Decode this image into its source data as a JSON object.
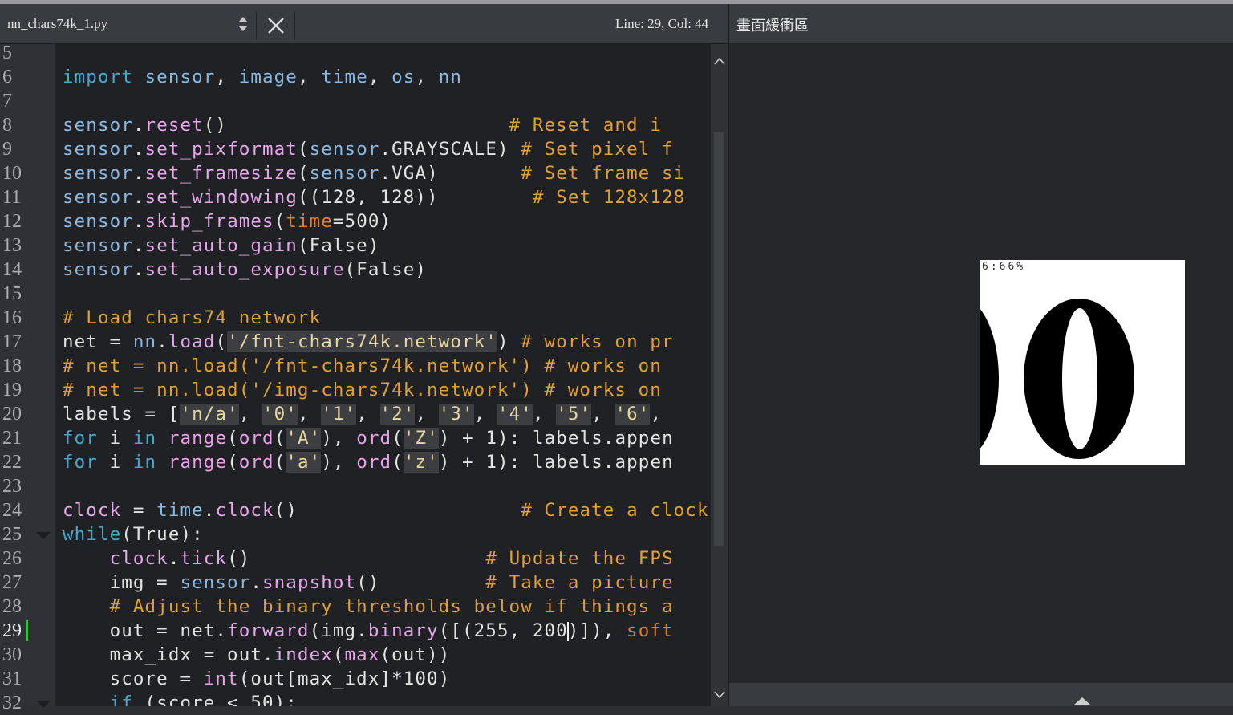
{
  "editor": {
    "file_name": "nn_chars74k_1.py",
    "cursor_position": "Line: 29, Col: 44",
    "lines": [
      {
        "n": "5"
      },
      {
        "n": "6"
      },
      {
        "n": "7"
      },
      {
        "n": "8"
      },
      {
        "n": "9"
      },
      {
        "n": "10"
      },
      {
        "n": "11"
      },
      {
        "n": "12"
      },
      {
        "n": "13"
      },
      {
        "n": "14"
      },
      {
        "n": "15"
      },
      {
        "n": "16"
      },
      {
        "n": "17"
      },
      {
        "n": "18"
      },
      {
        "n": "19"
      },
      {
        "n": "20"
      },
      {
        "n": "21"
      },
      {
        "n": "22"
      },
      {
        "n": "23"
      },
      {
        "n": "24"
      },
      {
        "n": "25"
      },
      {
        "n": "26"
      },
      {
        "n": "27"
      },
      {
        "n": "28"
      },
      {
        "n": "29"
      },
      {
        "n": "30"
      },
      {
        "n": "31"
      },
      {
        "n": "32"
      }
    ],
    "current_line": "29",
    "code": {
      "l6": [
        "import",
        " sensor",
        ", ",
        "image",
        ", ",
        "time",
        ", ",
        "os",
        ", ",
        "nn"
      ],
      "l8": [
        "sensor",
        ".",
        "reset",
        "()",
        "                        ",
        "# Reset and i"
      ],
      "l9": [
        "sensor",
        ".",
        "set_pixformat",
        "(",
        "sensor",
        ".GRAYSCALE) ",
        "# Set pixel f"
      ],
      "l10": [
        "sensor",
        ".",
        "set_framesize",
        "(",
        "sensor",
        ".VGA)       ",
        "# Set frame si"
      ],
      "l11": [
        "sensor",
        ".",
        "set_windowing",
        "((128, 128))        ",
        "# Set 128x128"
      ],
      "l12": [
        "sensor",
        ".",
        "skip_frames",
        "(",
        "time",
        "=500)"
      ],
      "l13": [
        "sensor",
        ".",
        "set_auto_gain",
        "(False)"
      ],
      "l14": [
        "sensor",
        ".",
        "set_auto_exposure",
        "(False)"
      ],
      "l16": [
        "# Load chars74 network"
      ],
      "l17": [
        "net = ",
        "nn",
        ".",
        "load",
        "(",
        "'/fnt-chars74k.network'",
        ") ",
        "# works on pr"
      ],
      "l18": [
        "# net = nn.load('/fnt-chars74k.network') # works on"
      ],
      "l19": [
        "# net = nn.load('/img-chars74k.network') # works on"
      ],
      "l20": [
        "labels = [",
        "'n/a'",
        ", ",
        "'0'",
        ", ",
        "'1'",
        ", ",
        "'2'",
        ", ",
        "'3'",
        ", ",
        "'4'",
        ", ",
        "'5'",
        ", ",
        "'6'",
        ","
      ],
      "l21": [
        "for",
        " i ",
        "in",
        " ",
        "range",
        "(",
        "ord",
        "(",
        "'A'",
        "), ",
        "ord",
        "(",
        "'Z'",
        ") + 1): labels.appen"
      ],
      "l22": [
        "for",
        " i ",
        "in",
        " ",
        "range",
        "(",
        "ord",
        "(",
        "'a'",
        "), ",
        "ord",
        "(",
        "'z'",
        ") + 1): labels.appen"
      ],
      "l24": [
        "clock",
        " = ",
        "time",
        ".",
        "clock",
        "()",
        "                   ",
        "# Create a clock"
      ],
      "l25": [
        "while",
        "(True):"
      ],
      "l26": [
        "    ",
        "clock",
        ".",
        "tick",
        "()",
        "                    ",
        "# Update the FPS"
      ],
      "l27": [
        "    img = ",
        "sensor",
        ".",
        "snapshot",
        "()         ",
        "# Take a picture"
      ],
      "l28": [
        "    # Adjust the binary thresholds below if things a"
      ],
      "l29": [
        "    out = net.",
        "forward",
        "(img.",
        "binary",
        "([(255, 200",
        ")]), ",
        "soft"
      ],
      "l30": [
        "    max_idx = out.",
        "index",
        "(",
        "max",
        "(out))"
      ],
      "l31": [
        "    score = ",
        "int",
        "(out[max_idx]*100)"
      ],
      "l32": [
        "    ",
        "if",
        " (score < 50):"
      ]
    }
  },
  "frame_buffer": {
    "title": "畫面緩衝區",
    "overlay_text": "6:66%",
    "image_description_digits": "00"
  }
}
